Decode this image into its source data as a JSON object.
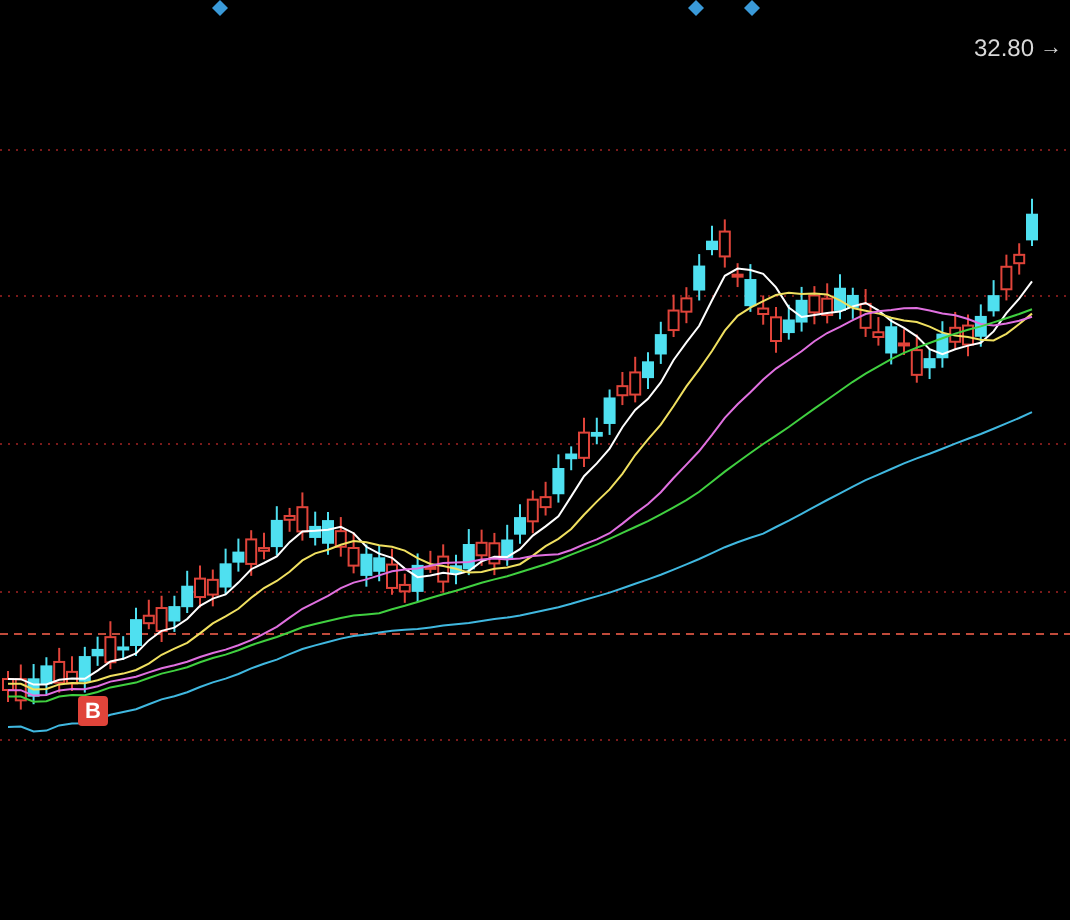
{
  "chart": {
    "price_label": "32.80",
    "price_arrow": "→",
    "signal": {
      "kind": "buy",
      "label": "B"
    }
  }
}
